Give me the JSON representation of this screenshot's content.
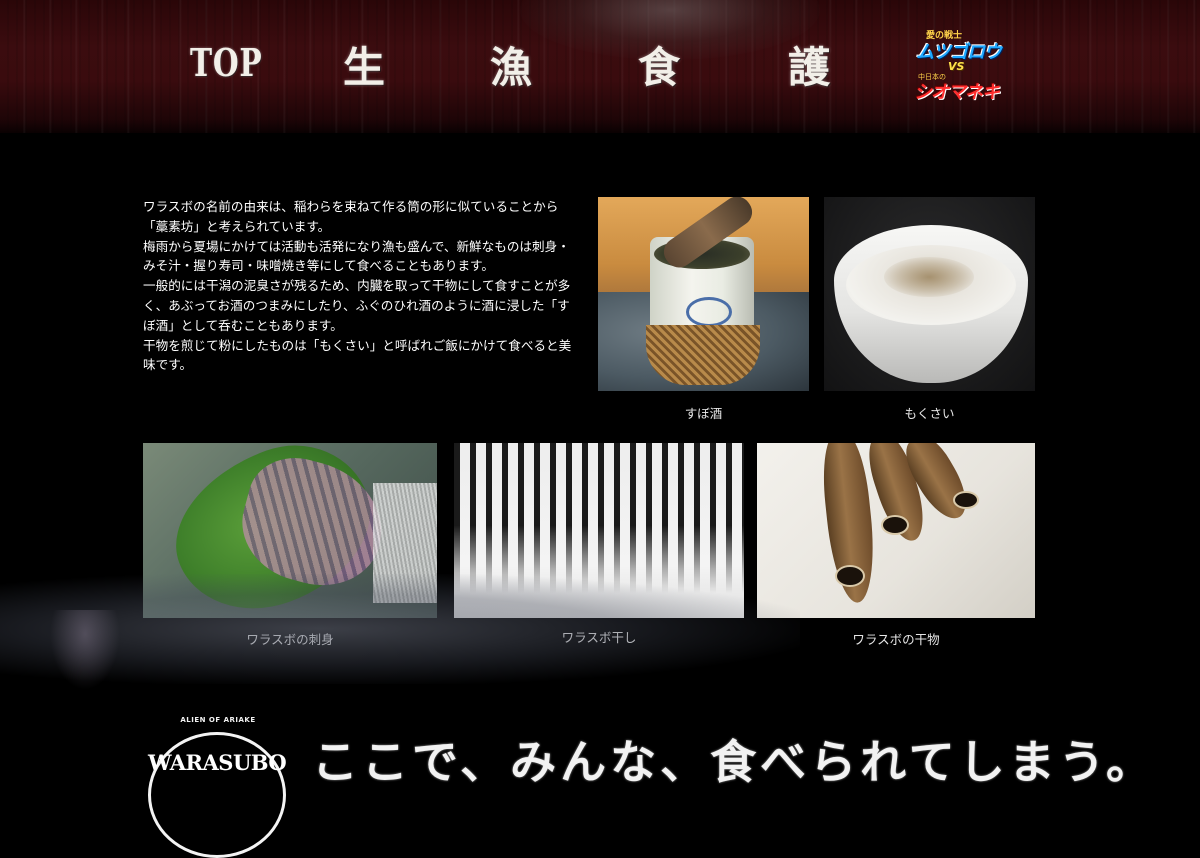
{
  "header": {
    "nav": [
      {
        "label": "TOP"
      },
      {
        "label": "生"
      },
      {
        "label": "漁"
      },
      {
        "label": "食"
      },
      {
        "label": "護"
      }
    ],
    "promo": {
      "line1": "愛の戦士",
      "line2": "ムツゴロウ",
      "line3": "VS",
      "line4": "中日本の",
      "line5": "シオマネキ"
    }
  },
  "intro": {
    "paragraphs": [
      "ワラスボの名前の由来は、稲わらを束ねて作る筒の形に似ていることから「藁素坊」と考えられています。",
      "梅雨から夏場にかけては活動も活発になり漁も盛んで、新鮮なものは刺身・みそ汁・握り寿司・味噌焼き等にして食べることもあります。",
      "一般的には干潟の泥臭さが残るため、内臓を取って干物にして食すことが多く、あぶってお酒のつまみにしたり、ふぐのひれ酒のように酒に浸した「すぼ酒」として呑むこともあります。",
      "干物を煎じて粉にしたものは「もくさい」と呼ばれご飯にかけて食べると美味です。"
    ]
  },
  "photos": [
    {
      "caption": "すぼ酒"
    },
    {
      "caption": "もくさい"
    },
    {
      "caption": "ワラスボの刺身"
    },
    {
      "caption": "ワラスボ干し"
    },
    {
      "caption": "ワラスボの干物"
    }
  ],
  "footer": {
    "badge_top": "ALIEN OF ARIAKE",
    "badge_name": "WARASUBO",
    "slogan": "ここで、みんな、食べられてしまう。"
  }
}
